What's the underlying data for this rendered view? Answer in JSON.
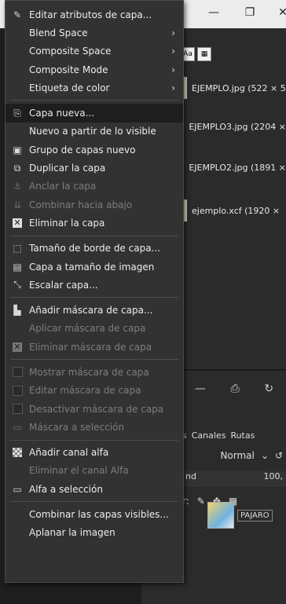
{
  "background": {
    "window_controls": [
      "—",
      "❐",
      "✕"
    ],
    "tab_icons": [
      "Aa",
      "▦"
    ],
    "images": [
      "EJEMPLO.jpg (522 × 5",
      "EJEMPLO3.jpg (2204 ×",
      "EJEMPLO2.jpg (1891 ×",
      "ejemplo.xcf (1920 ×"
    ],
    "dock_tabs": [
      "s",
      "Canales",
      "Rutas"
    ],
    "mode": "Normal",
    "opacity_label": "nd",
    "opacity_value": "100,",
    "lock_label": "r:",
    "layer_name": "PAJARO"
  },
  "menu": {
    "items": [
      {
        "label": "Editar atributos de capa...",
        "icon": "edit-attributes-icon",
        "glyph": "✎",
        "state": "normal"
      },
      {
        "label": "Blend Space",
        "submenu": true,
        "state": "normal"
      },
      {
        "label": "Composite Space",
        "submenu": true,
        "state": "normal"
      },
      {
        "label": "Composite Mode",
        "submenu": true,
        "state": "normal"
      },
      {
        "label": "Etiqueta de color",
        "submenu": true,
        "state": "normal"
      },
      {
        "separator": true
      },
      {
        "label": "Capa nueva...",
        "icon": "new-layer-icon",
        "glyph": "⎘",
        "state": "active"
      },
      {
        "label": "Nuevo a partir de lo visible",
        "state": "normal"
      },
      {
        "label": "Grupo de capas nuevo",
        "icon": "layer-group-icon",
        "glyph": "▣",
        "state": "normal"
      },
      {
        "label": "Duplicar la capa",
        "icon": "duplicate-icon",
        "glyph": "⧉",
        "state": "normal"
      },
      {
        "label": "Anclar la capa",
        "icon": "anchor-icon",
        "glyph": "⚓",
        "state": "disabled"
      },
      {
        "label": "Combinar hacia abajo",
        "icon": "merge-down-icon",
        "glyph": "⇊",
        "state": "disabled"
      },
      {
        "label": "Eliminar la capa",
        "icon": "delete-icon",
        "glyph": "✕",
        "state": "normal",
        "box": "x"
      },
      {
        "separator": true
      },
      {
        "label": "Tamaño de borde de capa...",
        "icon": "layer-boundary-icon",
        "glyph": "⬚",
        "state": "normal"
      },
      {
        "label": "Capa a tamaño de imagen",
        "icon": "layer-to-image-icon",
        "glyph": "▤",
        "state": "normal"
      },
      {
        "label": "Escalar capa...",
        "icon": "scale-icon",
        "glyph": "⤡",
        "state": "normal"
      },
      {
        "separator": true
      },
      {
        "label": "Añadir máscara de capa...",
        "icon": "add-mask-icon",
        "glyph": "▙",
        "state": "normal"
      },
      {
        "label": "Aplicar máscara de capa",
        "state": "disabled"
      },
      {
        "label": "Eliminar máscara de capa",
        "icon": "delete-mask-icon",
        "glyph": "✕",
        "state": "disabled",
        "box": "x"
      },
      {
        "separator": true
      },
      {
        "label": "Mostrar máscara de capa",
        "icon": "show-mask-checkbox",
        "state": "disabled",
        "box": "check"
      },
      {
        "label": "Editar máscara de capa",
        "icon": "edit-mask-checkbox",
        "state": "disabled",
        "box": "check"
      },
      {
        "label": "Desactivar máscara de capa",
        "icon": "disable-mask-checkbox",
        "state": "disabled",
        "box": "check"
      },
      {
        "label": "Máscara a selección",
        "icon": "mask-to-selection-icon",
        "glyph": "▭",
        "state": "disabled"
      },
      {
        "separator": true
      },
      {
        "label": "Añadir canal alfa",
        "icon": "add-alpha-icon",
        "state": "normal",
        "box": "checker"
      },
      {
        "label": "Eliminar el canal Alfa",
        "state": "disabled"
      },
      {
        "label": "Alfa a selección",
        "icon": "alpha-to-selection-icon",
        "glyph": "▭",
        "state": "normal"
      },
      {
        "separator": true
      },
      {
        "label": "Combinar las capas visibles...",
        "state": "normal"
      },
      {
        "label": "Aplanar la imagen",
        "state": "normal"
      }
    ]
  }
}
